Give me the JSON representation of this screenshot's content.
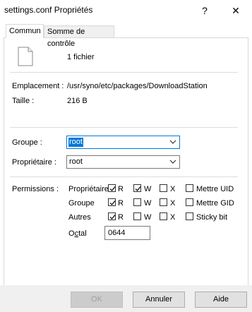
{
  "window": {
    "title": "settings.conf Propriétés",
    "help_glyph": "?",
    "close_glyph": "✕"
  },
  "tabs": [
    {
      "label": "Commun"
    },
    {
      "label": "Somme de contrôle"
    }
  ],
  "file": {
    "icon": "file-icon",
    "count_text": "1 fichier"
  },
  "info": {
    "location_label": "Emplacement :",
    "location_value": "/usr/syno/etc/packages/DownloadStation",
    "size_label": "Taille :",
    "size_value": "216 B"
  },
  "ownership": {
    "group_label": "Groupe :",
    "group_value": "root",
    "owner_label": "Propriétaire :",
    "owner_value": "root"
  },
  "permissions": {
    "label": "Permissions :",
    "rows": [
      {
        "name": "Propriétaire",
        "r": true,
        "w": true,
        "x": false,
        "extra": "Mettre UID",
        "extra_checked": false
      },
      {
        "name": "Groupe",
        "r": true,
        "w": false,
        "x": false,
        "extra": "Mettre GID",
        "extra_checked": false
      },
      {
        "name": "Autres",
        "r": true,
        "w": false,
        "x": false,
        "extra": "Sticky bit",
        "extra_checked": false
      }
    ],
    "r_label": "R",
    "w_label": "W",
    "x_label": "X",
    "octal_label_pre": "O",
    "octal_label_acc": "c",
    "octal_label_post": "tal",
    "octal_value": "0644"
  },
  "buttons": {
    "ok": "OK",
    "cancel": "Annuler",
    "help": "Aide"
  }
}
